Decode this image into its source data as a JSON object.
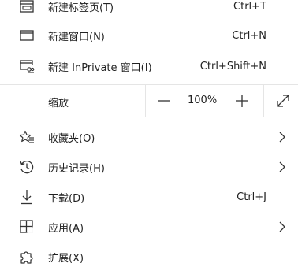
{
  "menu": {
    "items_top": [
      {
        "label": "新建标签页(T)",
        "shortcut": "Ctrl+T",
        "icon": "new-tab-icon"
      },
      {
        "label": "新建窗口(N)",
        "shortcut": "Ctrl+N",
        "icon": "new-window-icon"
      },
      {
        "label": "新建 InPrivate 窗口(I)",
        "shortcut": "Ctrl+Shift+N",
        "icon": "inprivate-window-icon"
      }
    ],
    "zoom": {
      "label": "缩放",
      "minus": "—",
      "value": "100%",
      "plus": "+",
      "fullscreen_icon": "expand-icon"
    },
    "items_bottom": [
      {
        "label": "收藏夹(O)",
        "icon": "favorites-icon",
        "chevron": ">"
      },
      {
        "label": "历史记录(H)",
        "icon": "history-icon",
        "chevron": ">"
      },
      {
        "label": "下载(D)",
        "shortcut": "Ctrl+J",
        "icon": "download-icon"
      },
      {
        "label": "应用(A)",
        "icon": "apps-icon",
        "chevron": ">"
      },
      {
        "label": "扩展(X)",
        "icon": "extensions-icon"
      }
    ]
  },
  "colors": {
    "text": "#222222",
    "icon": "#333333",
    "divider": "#e5e5e5",
    "background": "#ffffff"
  }
}
